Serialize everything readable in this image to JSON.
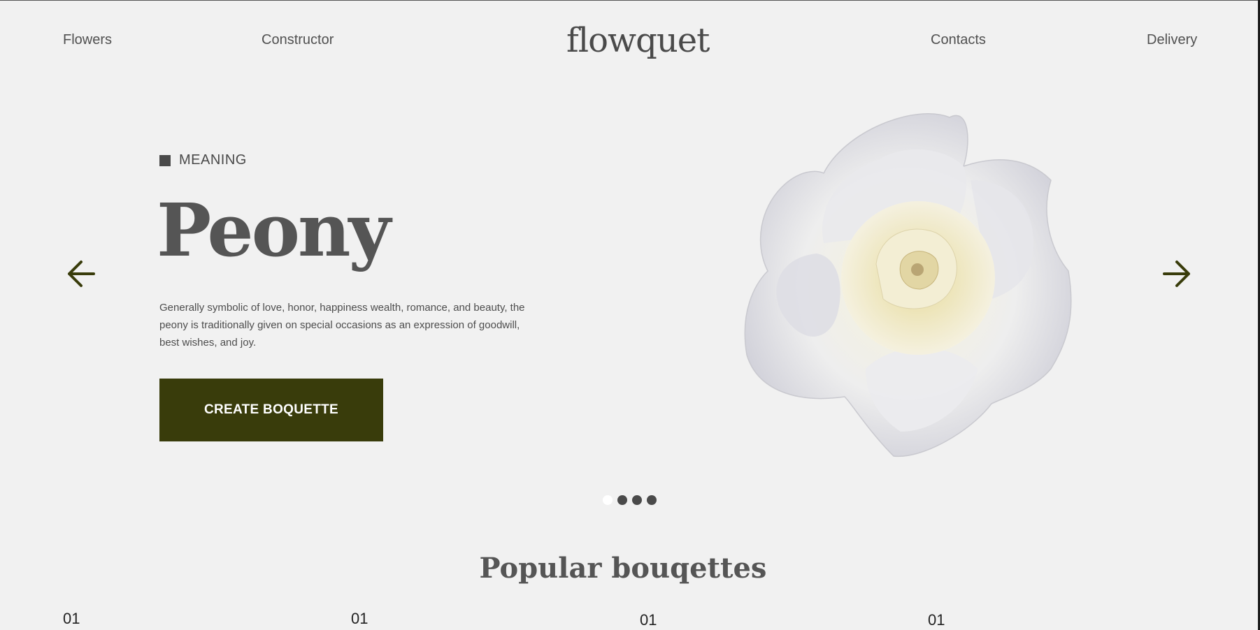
{
  "nav": {
    "left": [
      "Flowers",
      "Constructor"
    ],
    "logo": "flowquet",
    "right": [
      "Contacts",
      "Delivery"
    ]
  },
  "hero": {
    "eyebrow": "MEANING",
    "title": "Peony",
    "description": "Generally symbolic of love, honor, happiness wealth, romance, and beauty, the peony is traditionally given on special occasions as an expression of goodwill, best wishes, and joy.",
    "cta_label": "CREATE BOQUETTE"
  },
  "carousel": {
    "prev_icon": "arrow-left-icon",
    "next_icon": "arrow-right-icon",
    "dot_count": 4,
    "active_dot": 1
  },
  "popular": {
    "title": "Popular bouqettes",
    "cards": [
      {
        "number": "01"
      },
      {
        "number": "01"
      },
      {
        "number": "01"
      },
      {
        "number": "01"
      }
    ]
  },
  "colors": {
    "accent": "#393c0b",
    "background": "#f1f1f1",
    "text": "#4a4a4a"
  }
}
